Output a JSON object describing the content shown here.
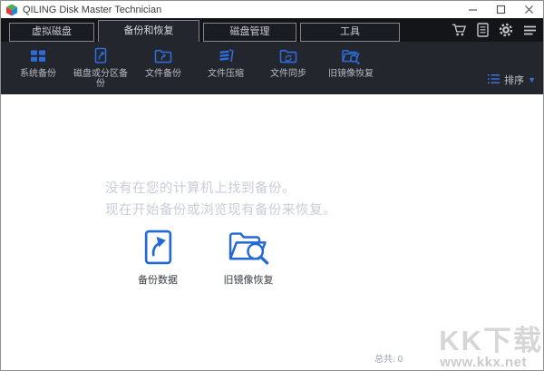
{
  "window": {
    "title": "QILING Disk Master Technician",
    "controls": {
      "minimize": "minimize",
      "maximize": "maximize",
      "close": "close"
    }
  },
  "tabs": [
    {
      "label": "虚拟磁盘",
      "active": false
    },
    {
      "label": "备份和恢复",
      "active": true
    },
    {
      "label": "磁盘管理",
      "active": false
    },
    {
      "label": "工具",
      "active": false
    }
  ],
  "tabbar_icons": [
    "cart-icon",
    "license-icon",
    "gear-icon",
    "menu-icon"
  ],
  "toolbar": {
    "items": [
      {
        "icon": "system-backup-icon",
        "label": "系统备份"
      },
      {
        "icon": "disk-partition-backup-icon",
        "label": "磁盘或分区备份"
      },
      {
        "icon": "file-backup-icon",
        "label": "文件备份"
      },
      {
        "icon": "file-compress-icon",
        "label": "文件压缩"
      },
      {
        "icon": "file-sync-icon",
        "label": "文件同步"
      },
      {
        "icon": "old-image-restore-icon",
        "label": "旧镜像恢复"
      }
    ],
    "sort_label": "排序"
  },
  "content": {
    "empty_line1": "没有在您的计算机上找到备份。",
    "empty_line2": "现在开始备份或浏览现有备份来恢复。",
    "actions": [
      {
        "icon": "backup-data-icon",
        "label": "备份数据"
      },
      {
        "icon": "old-image-restore-icon",
        "label": "旧镜像恢复"
      }
    ]
  },
  "statusbar": {
    "total_label": "总共:",
    "total_value": "0"
  },
  "watermark": {
    "big": "KK下载",
    "url": "www.kkx.net"
  },
  "colors": {
    "accent_blue": "#2f6cd9",
    "toolbar_bg": "#23262c",
    "tabbar_bg": "#131519",
    "empty_text": "#c9cdd9",
    "watermark": "#d6d6d6"
  }
}
